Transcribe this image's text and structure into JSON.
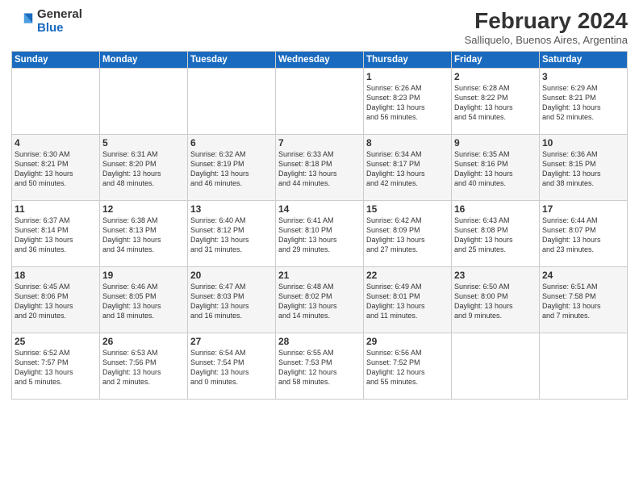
{
  "logo": {
    "general": "General",
    "blue": "Blue"
  },
  "title": "February 2024",
  "location": "Salliquelo, Buenos Aires, Argentina",
  "weekdays": [
    "Sunday",
    "Monday",
    "Tuesday",
    "Wednesday",
    "Thursday",
    "Friday",
    "Saturday"
  ],
  "weeks": [
    [
      {
        "day": "",
        "detail": ""
      },
      {
        "day": "",
        "detail": ""
      },
      {
        "day": "",
        "detail": ""
      },
      {
        "day": "",
        "detail": ""
      },
      {
        "day": "1",
        "detail": "Sunrise: 6:26 AM\nSunset: 8:23 PM\nDaylight: 13 hours\nand 56 minutes."
      },
      {
        "day": "2",
        "detail": "Sunrise: 6:28 AM\nSunset: 8:22 PM\nDaylight: 13 hours\nand 54 minutes."
      },
      {
        "day": "3",
        "detail": "Sunrise: 6:29 AM\nSunset: 8:21 PM\nDaylight: 13 hours\nand 52 minutes."
      }
    ],
    [
      {
        "day": "4",
        "detail": "Sunrise: 6:30 AM\nSunset: 8:21 PM\nDaylight: 13 hours\nand 50 minutes."
      },
      {
        "day": "5",
        "detail": "Sunrise: 6:31 AM\nSunset: 8:20 PM\nDaylight: 13 hours\nand 48 minutes."
      },
      {
        "day": "6",
        "detail": "Sunrise: 6:32 AM\nSunset: 8:19 PM\nDaylight: 13 hours\nand 46 minutes."
      },
      {
        "day": "7",
        "detail": "Sunrise: 6:33 AM\nSunset: 8:18 PM\nDaylight: 13 hours\nand 44 minutes."
      },
      {
        "day": "8",
        "detail": "Sunrise: 6:34 AM\nSunset: 8:17 PM\nDaylight: 13 hours\nand 42 minutes."
      },
      {
        "day": "9",
        "detail": "Sunrise: 6:35 AM\nSunset: 8:16 PM\nDaylight: 13 hours\nand 40 minutes."
      },
      {
        "day": "10",
        "detail": "Sunrise: 6:36 AM\nSunset: 8:15 PM\nDaylight: 13 hours\nand 38 minutes."
      }
    ],
    [
      {
        "day": "11",
        "detail": "Sunrise: 6:37 AM\nSunset: 8:14 PM\nDaylight: 13 hours\nand 36 minutes."
      },
      {
        "day": "12",
        "detail": "Sunrise: 6:38 AM\nSunset: 8:13 PM\nDaylight: 13 hours\nand 34 minutes."
      },
      {
        "day": "13",
        "detail": "Sunrise: 6:40 AM\nSunset: 8:12 PM\nDaylight: 13 hours\nand 31 minutes."
      },
      {
        "day": "14",
        "detail": "Sunrise: 6:41 AM\nSunset: 8:10 PM\nDaylight: 13 hours\nand 29 minutes."
      },
      {
        "day": "15",
        "detail": "Sunrise: 6:42 AM\nSunset: 8:09 PM\nDaylight: 13 hours\nand 27 minutes."
      },
      {
        "day": "16",
        "detail": "Sunrise: 6:43 AM\nSunset: 8:08 PM\nDaylight: 13 hours\nand 25 minutes."
      },
      {
        "day": "17",
        "detail": "Sunrise: 6:44 AM\nSunset: 8:07 PM\nDaylight: 13 hours\nand 23 minutes."
      }
    ],
    [
      {
        "day": "18",
        "detail": "Sunrise: 6:45 AM\nSunset: 8:06 PM\nDaylight: 13 hours\nand 20 minutes."
      },
      {
        "day": "19",
        "detail": "Sunrise: 6:46 AM\nSunset: 8:05 PM\nDaylight: 13 hours\nand 18 minutes."
      },
      {
        "day": "20",
        "detail": "Sunrise: 6:47 AM\nSunset: 8:03 PM\nDaylight: 13 hours\nand 16 minutes."
      },
      {
        "day": "21",
        "detail": "Sunrise: 6:48 AM\nSunset: 8:02 PM\nDaylight: 13 hours\nand 14 minutes."
      },
      {
        "day": "22",
        "detail": "Sunrise: 6:49 AM\nSunset: 8:01 PM\nDaylight: 13 hours\nand 11 minutes."
      },
      {
        "day": "23",
        "detail": "Sunrise: 6:50 AM\nSunset: 8:00 PM\nDaylight: 13 hours\nand 9 minutes."
      },
      {
        "day": "24",
        "detail": "Sunrise: 6:51 AM\nSunset: 7:58 PM\nDaylight: 13 hours\nand 7 minutes."
      }
    ],
    [
      {
        "day": "25",
        "detail": "Sunrise: 6:52 AM\nSunset: 7:57 PM\nDaylight: 13 hours\nand 5 minutes."
      },
      {
        "day": "26",
        "detail": "Sunrise: 6:53 AM\nSunset: 7:56 PM\nDaylight: 13 hours\nand 2 minutes."
      },
      {
        "day": "27",
        "detail": "Sunrise: 6:54 AM\nSunset: 7:54 PM\nDaylight: 13 hours\nand 0 minutes."
      },
      {
        "day": "28",
        "detail": "Sunrise: 6:55 AM\nSunset: 7:53 PM\nDaylight: 12 hours\nand 58 minutes."
      },
      {
        "day": "29",
        "detail": "Sunrise: 6:56 AM\nSunset: 7:52 PM\nDaylight: 12 hours\nand 55 minutes."
      },
      {
        "day": "",
        "detail": ""
      },
      {
        "day": "",
        "detail": ""
      }
    ]
  ]
}
